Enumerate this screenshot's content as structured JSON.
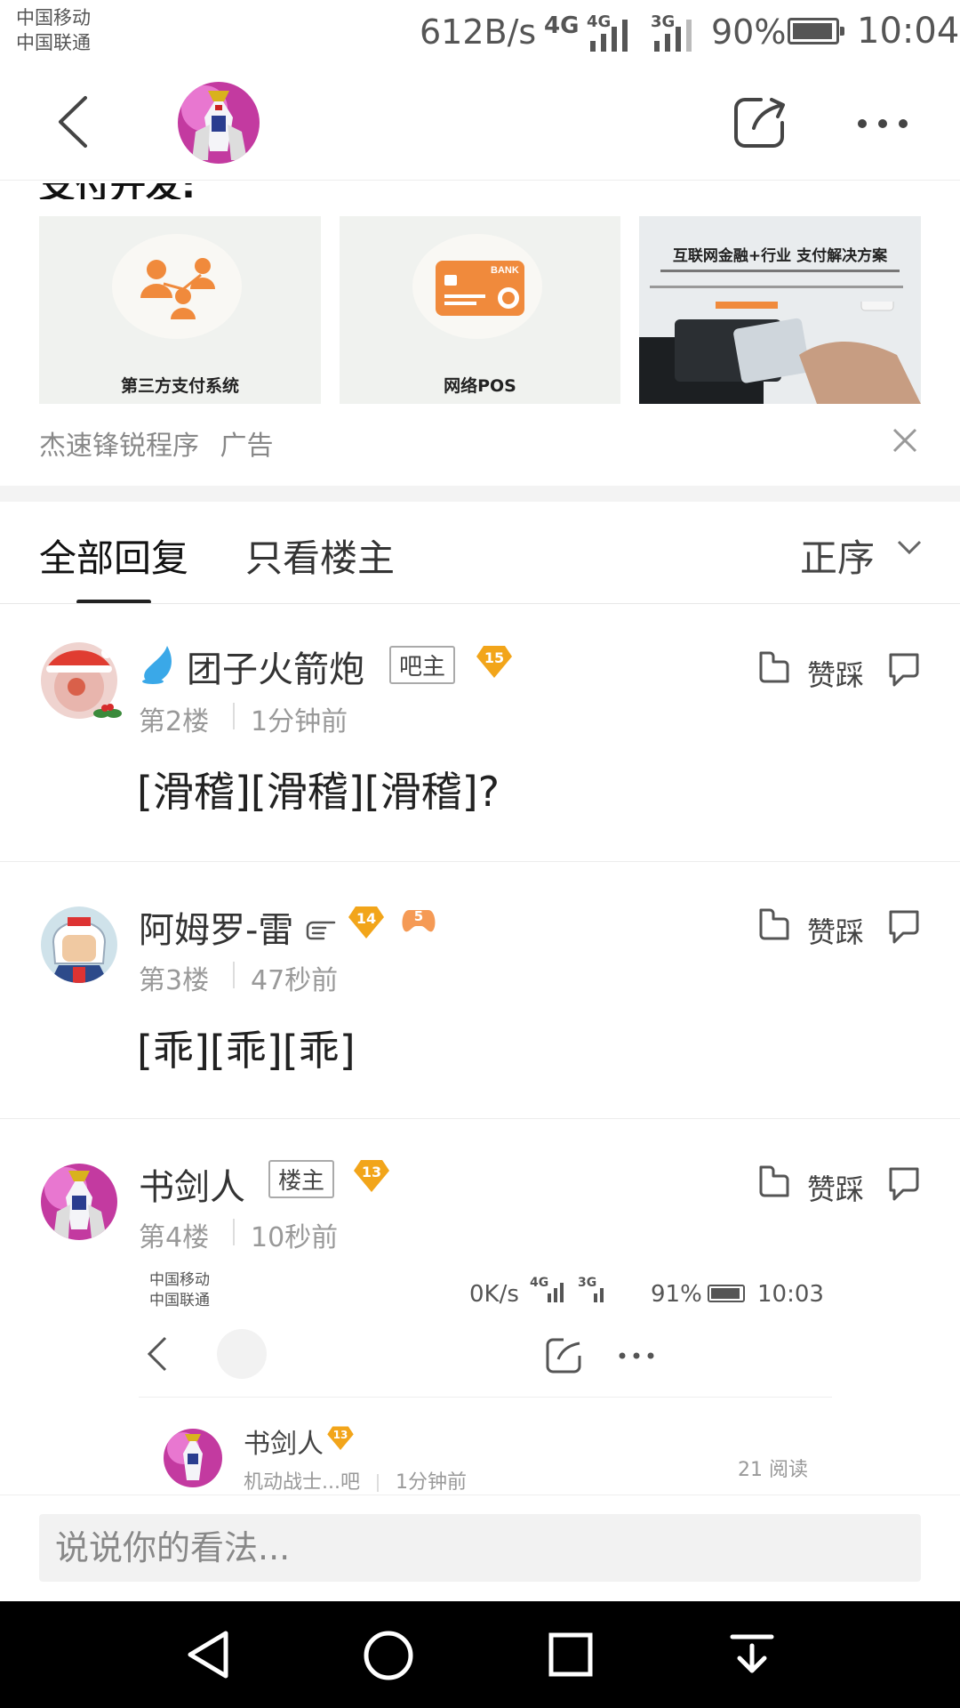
{
  "status_bar": {
    "carrier_1": "中国移动",
    "carrier_2": "中国联通",
    "net_speed": "612B/s",
    "sim1_type": "4G",
    "sim1_signal_type": "4G",
    "sim2_type": "3G",
    "battery": "90%",
    "battery_level": 0.9,
    "time": "10:04"
  },
  "ad": {
    "heading_clipped": "支付开发:",
    "tiles": [
      {
        "caption": "第三方支付系统",
        "icon": "people-network-icon"
      },
      {
        "caption": "网络POS",
        "icon": "bank-card-icon"
      },
      {
        "caption": "互联网金融+行业  支付解决方案",
        "icon": "pos-terminal-photo"
      }
    ],
    "card_badge": "BANK",
    "source": "杰速锋锐程序",
    "label": "广告"
  },
  "tabs": {
    "all": "全部回复",
    "author_only": "只看楼主",
    "sort": "正序"
  },
  "posts": [
    {
      "username": "团子火箭炮",
      "role": "吧主",
      "level": "15",
      "floor": "第2楼",
      "time": "1分钟前",
      "content": "[滑稽][滑稽][滑稽]?",
      "vote_label": "赞踩"
    },
    {
      "username": "阿姆罗-雷",
      "level": "14",
      "badge2": "5",
      "floor": "第3楼",
      "time": "47秒前",
      "content": "[乖][乖][乖]",
      "vote_label": "赞踩"
    },
    {
      "username": "书剑人",
      "role": "楼主",
      "level": "13",
      "floor": "第4楼",
      "time": "10秒前",
      "vote_label": "赞踩"
    }
  ],
  "embedded_screenshot": {
    "carrier_1": "中国移动",
    "carrier_2": "中国联通",
    "net_speed": "0K/s",
    "sim1_type": "4G",
    "sim2_type": "3G",
    "battery": "91%",
    "time": "10:03",
    "author": "书剑人",
    "level": "13",
    "forum": "机动战士...吧",
    "post_time": "1分钟前",
    "reads": "21 阅读"
  },
  "reply_input": {
    "placeholder": "说说你的看法..."
  },
  "colors": {
    "level_badge": "#f2a51a",
    "ad_orange": "#f08a3c",
    "water_drop": "#3aa8e8"
  }
}
